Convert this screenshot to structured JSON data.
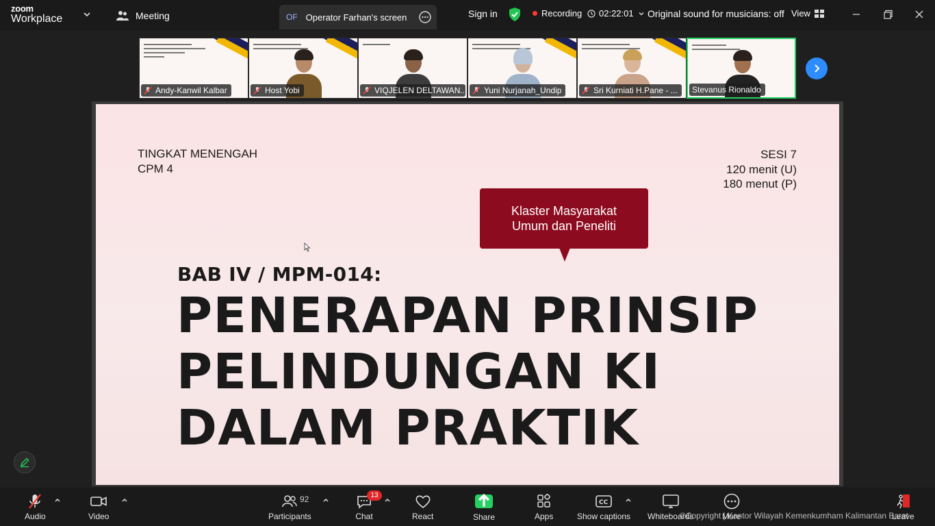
{
  "app": {
    "brand_top": "zoom",
    "brand_bottom": "Workplace"
  },
  "topbar": {
    "meeting_label": "Meeting",
    "share_tab_badge": "OF",
    "share_tab_label": "Operator Farhan's screen",
    "signin": "Sign in",
    "recording": "Recording",
    "timer": "02:22:01",
    "original_sound": "Original sound for musicians: off",
    "view": "View"
  },
  "participants_strip": [
    {
      "name": "Andy-Kanwil Kalbar",
      "muted": true,
      "video": "slide"
    },
    {
      "name": "Host Yobi",
      "muted": true,
      "video": "person"
    },
    {
      "name": "VIQJELEN DELTAWAN...",
      "muted": true,
      "video": "person"
    },
    {
      "name": "Yuni Nurjanah_Undip",
      "muted": true,
      "video": "person"
    },
    {
      "name": "Sri Kurniati H.Pane - ...",
      "muted": true,
      "video": "person"
    },
    {
      "name": "Stevanus Rionaldo",
      "muted": false,
      "video": "person",
      "active": true
    }
  ],
  "slide": {
    "level_line1": "TINGKAT MENENGAH",
    "level_line2": "CPM 4",
    "session_line1": "SESI 7",
    "session_line2": "120 menit (U)",
    "session_line3": "180 menut (P)",
    "bubble_line1": "Klaster Masyarakat",
    "bubble_line2": "Umum dan Peneliti",
    "chapter": "BAB IV / MPM-014:",
    "title_line1": "PENERAPAN PRINSIP",
    "title_line2": "PELINDUNGAN KI",
    "title_line3": "DALAM PRAKTIK"
  },
  "toolbar": {
    "audio": "Audio",
    "video": "Video",
    "participants": "Participants",
    "participants_count": "92",
    "chat": "Chat",
    "chat_badge": "13",
    "react": "React",
    "share": "Share",
    "apps": "Apps",
    "captions": "Show captions",
    "whiteboards": "Whiteboards",
    "more": "More",
    "leave": "Leave",
    "copyright": "©Copyright | Kantor Wilayah Kemenkumham Kalimantan Barat"
  },
  "colors": {
    "accent_blue": "#2d8cff",
    "share_green": "#23d160",
    "record_red": "#ff3b30",
    "bubble_red": "#8c0b1f"
  }
}
